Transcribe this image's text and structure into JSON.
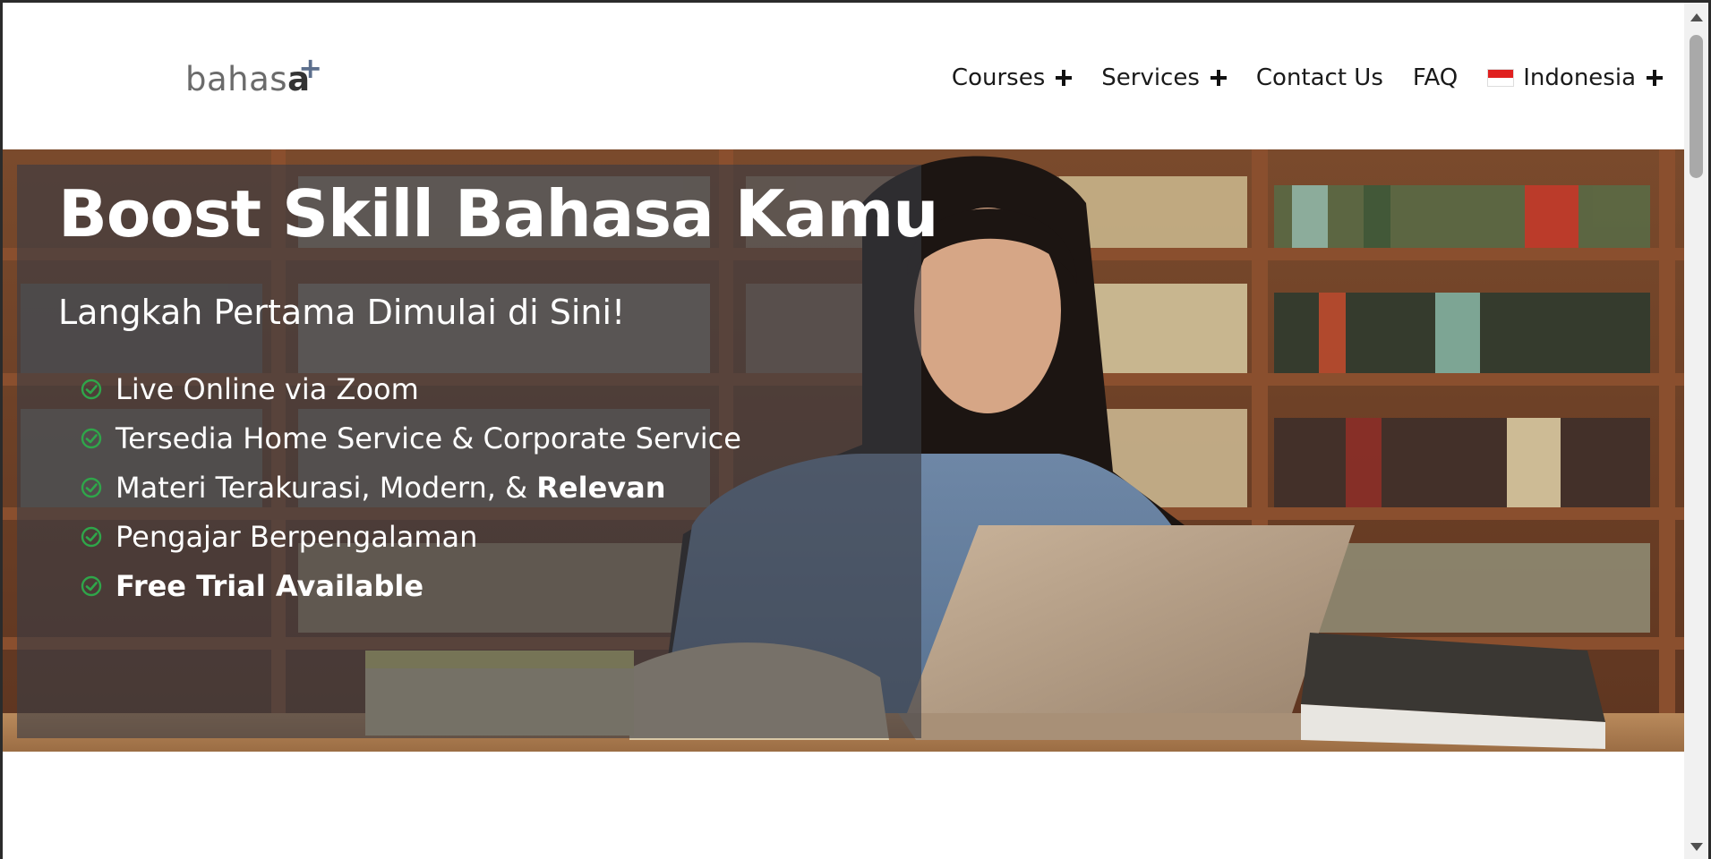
{
  "header": {
    "logo": {
      "text": "bahas",
      "bold_letter": "a",
      "superscript": "+"
    },
    "nav": [
      {
        "label": "Courses",
        "has_dropdown": true
      },
      {
        "label": "Services",
        "has_dropdown": true
      },
      {
        "label": "Contact Us",
        "has_dropdown": false
      },
      {
        "label": "FAQ",
        "has_dropdown": false
      }
    ],
    "language": {
      "label": "Indonesia",
      "flag_icon": "indonesia-flag-icon",
      "has_dropdown": true
    }
  },
  "hero": {
    "title": "Boost Skill Bahasa Kamu",
    "subtitle": "Langkah Pertama Dimulai di Sini!",
    "features": [
      {
        "text": "Live Online via Zoom",
        "bold": ""
      },
      {
        "text": "Tersedia Home Service & Corporate Service",
        "bold": ""
      },
      {
        "text": "Materi Terakurasi, Modern, & ",
        "bold": "Relevan"
      },
      {
        "text": "Pengajar Berpengalaman",
        "bold": ""
      },
      {
        "text": "",
        "bold": "Free Trial Available"
      }
    ],
    "check_icon": "check-circle-icon",
    "colors": {
      "overlay": "#3a3c44",
      "check": "#2fa64a",
      "text": "#ffffff"
    }
  }
}
